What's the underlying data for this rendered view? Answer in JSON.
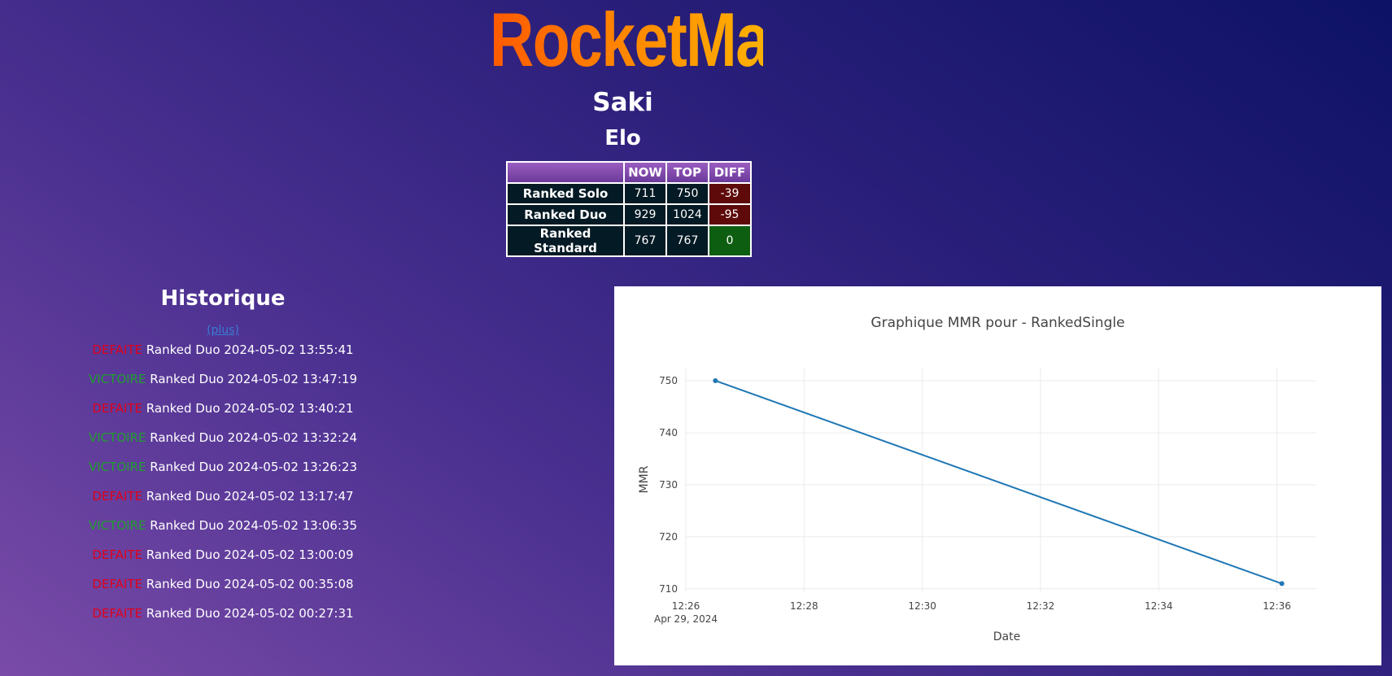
{
  "app": {
    "logo": "RocketMax"
  },
  "player": {
    "name": "Saki"
  },
  "elo": {
    "title": "Elo",
    "headers": [
      "",
      "NOW",
      "TOP",
      "DIFF"
    ],
    "rows": [
      {
        "label": "Ranked Solo",
        "now": "711",
        "top": "750",
        "diff": "-39",
        "diff_sign": "neg"
      },
      {
        "label": "Ranked Duo",
        "now": "929",
        "top": "1024",
        "diff": "-95",
        "diff_sign": "neg"
      },
      {
        "label": "Ranked Standard",
        "now": "767",
        "top": "767",
        "diff": "0",
        "diff_sign": "pos"
      }
    ]
  },
  "history": {
    "title": "Historique",
    "more_label": "(plus)",
    "items": [
      {
        "result": "DEFAITE",
        "type": "defeat",
        "text": " Ranked Duo 2024-05-02 13:55:41"
      },
      {
        "result": "VICTOIRE",
        "type": "victory",
        "text": " Ranked Duo 2024-05-02 13:47:19"
      },
      {
        "result": "DEFAITE",
        "type": "defeat",
        "text": " Ranked Duo 2024-05-02 13:40:21"
      },
      {
        "result": "VICTOIRE",
        "type": "victory",
        "text": " Ranked Duo 2024-05-02 13:32:24"
      },
      {
        "result": "VICTOIRE",
        "type": "victory",
        "text": " Ranked Duo 2024-05-02 13:26:23"
      },
      {
        "result": "DEFAITE",
        "type": "defeat",
        "text": " Ranked Duo 2024-05-02 13:17:47"
      },
      {
        "result": "VICTOIRE",
        "type": "victory",
        "text": " Ranked Duo 2024-05-02 13:06:35"
      },
      {
        "result": "DEFAITE",
        "type": "defeat",
        "text": " Ranked Duo 2024-05-02 13:00:09"
      },
      {
        "result": "DEFAITE",
        "type": "defeat",
        "text": " Ranked Duo 2024-05-02 00:35:08"
      },
      {
        "result": "DEFAITE",
        "type": "defeat",
        "text": " Ranked Duo 2024-05-02 00:27:31"
      }
    ]
  },
  "chart_data": {
    "type": "line",
    "title": "Graphique MMR pour  - RankedSingle",
    "xlabel": "Date",
    "ylabel": "MMR",
    "x": [
      "2024-04-29 12:26:30",
      "2024-04-29 12:36:05"
    ],
    "y": [
      750,
      711
    ],
    "xlim": [
      "2024-04-29 12:26:00",
      "2024-04-29 12:36:40"
    ],
    "ylim": [
      709.5,
      752.5
    ],
    "x_ticks": [
      "12:26",
      "12:28",
      "12:30",
      "12:32",
      "12:34",
      "12:36"
    ],
    "x_tick_values": [
      "2024-04-29 12:26:00",
      "2024-04-29 12:28:00",
      "2024-04-29 12:30:00",
      "2024-04-29 12:32:00",
      "2024-04-29 12:34:00",
      "2024-04-29 12:36:00"
    ],
    "x_subtitle": "Apr 29, 2024",
    "y_ticks": [
      710,
      720,
      730,
      740,
      750
    ],
    "grid": true,
    "line_color": "#1f77b4"
  }
}
